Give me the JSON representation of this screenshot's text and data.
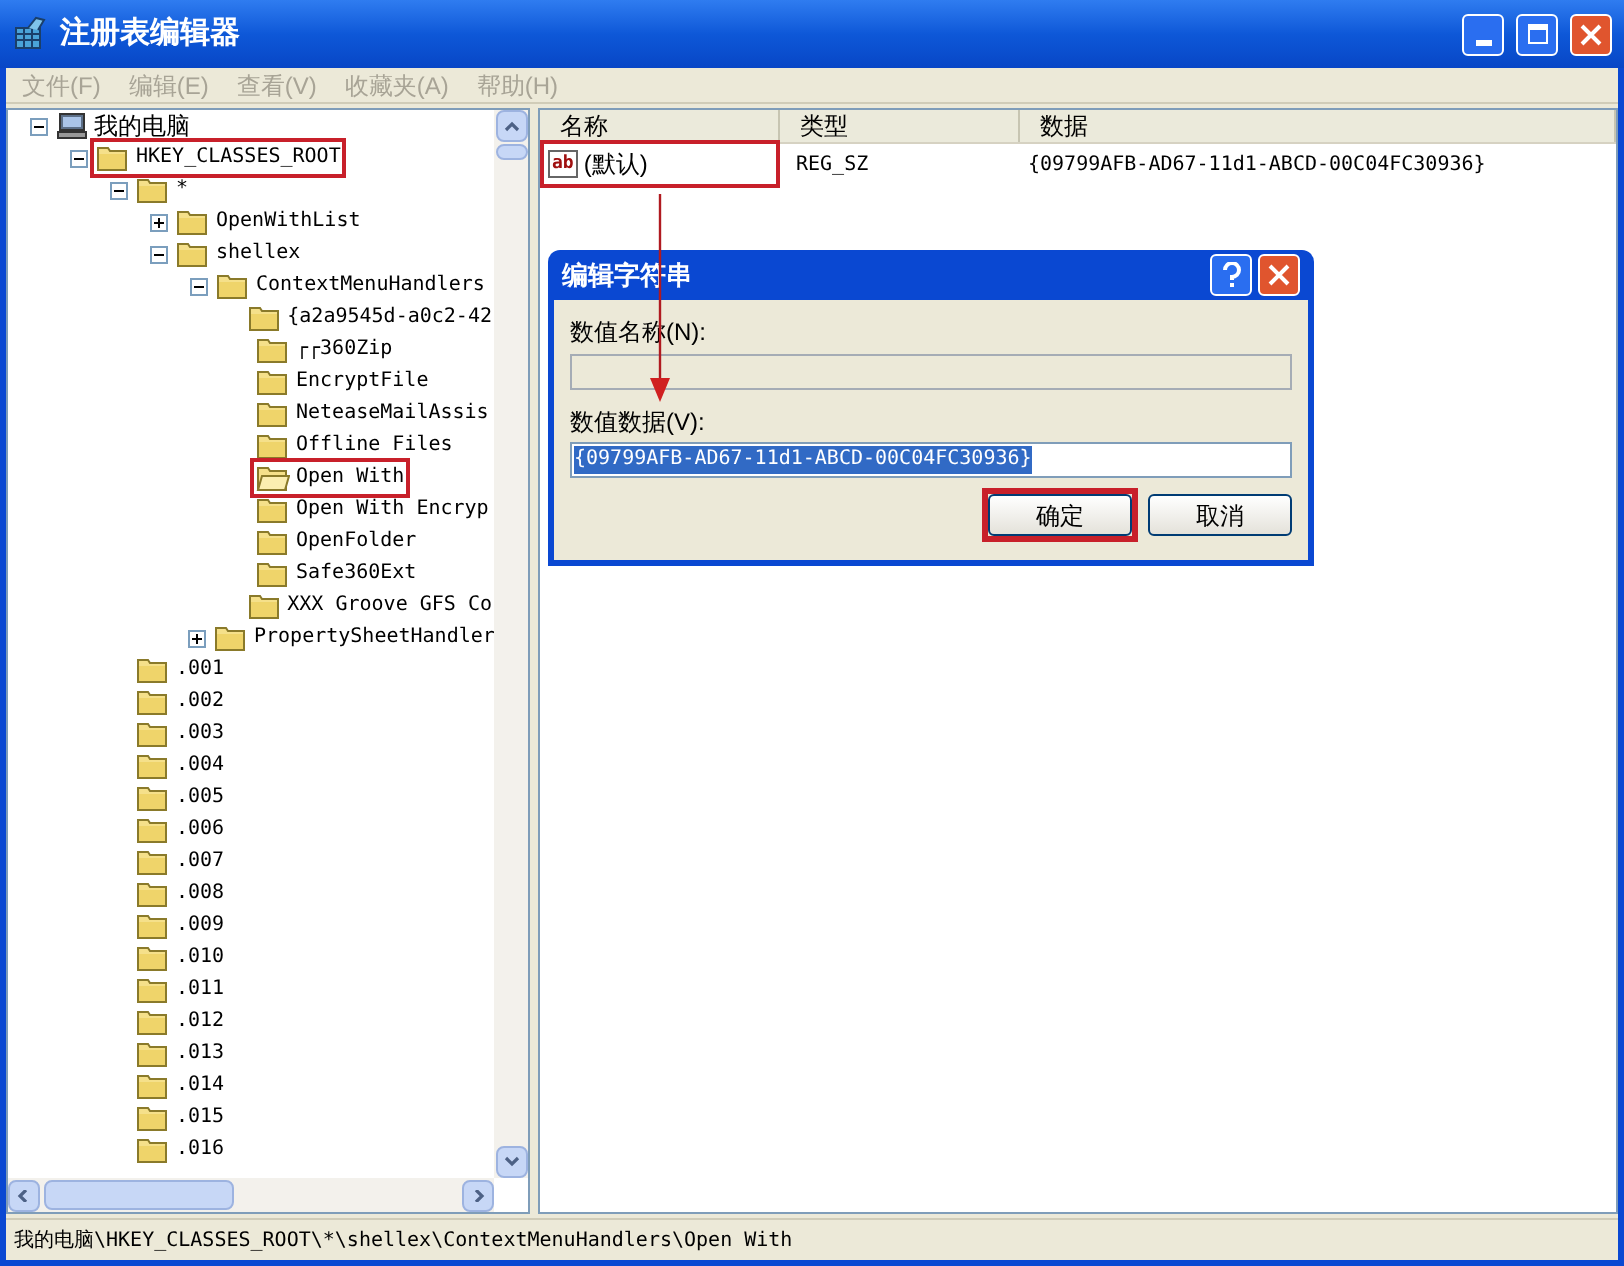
{
  "window": {
    "title": "注册表编辑器"
  },
  "menu": [
    {
      "label": "文件(F)"
    },
    {
      "label": "编辑(E)"
    },
    {
      "label": "查看(V)"
    },
    {
      "label": "收藏夹(A)"
    },
    {
      "label": "帮助(H)"
    }
  ],
  "tree": {
    "root": {
      "label": "我的电脑",
      "expanded": true,
      "highlighted": false,
      "children": [
        {
          "label": "HKEY_CLASSES_ROOT",
          "expanded": true,
          "selected": false,
          "highlighted": true,
          "children": [
            {
              "label": "*",
              "expanded": true,
              "selected": false,
              "highlighted": false,
              "children": [
                {
                  "label": "OpenWithList",
                  "expanded": false,
                  "selected": false,
                  "highlighted": false
                },
                {
                  "label": "shellex",
                  "expanded": true,
                  "selected": false,
                  "highlighted": false,
                  "children": [
                    {
                      "label": "ContextMenuHandlers",
                      "expanded": true,
                      "selected": false,
                      "highlighted": false,
                      "children": [
                        {
                          "label": "{a2a9545d-a0c2-42",
                          "selected": false,
                          "highlighted": false
                        },
                        {
                          "label": "┌┌360Zip",
                          "selected": false,
                          "highlighted": false
                        },
                        {
                          "label": "EncryptFile",
                          "selected": false,
                          "highlighted": false
                        },
                        {
                          "label": "NeteaseMailAssis",
                          "selected": false,
                          "highlighted": false
                        },
                        {
                          "label": "Offline Files",
                          "selected": false,
                          "highlighted": false
                        },
                        {
                          "label": "Open With",
                          "selected": true,
                          "highlighted": true
                        },
                        {
                          "label": "Open With Encryp",
                          "selected": false,
                          "highlighted": false
                        },
                        {
                          "label": "OpenFolder",
                          "selected": false,
                          "highlighted": false
                        },
                        {
                          "label": "Safe360Ext",
                          "selected": false,
                          "highlighted": false
                        },
                        {
                          "label": "XXX Groove GFS Co",
                          "selected": false,
                          "highlighted": false
                        }
                      ]
                    },
                    {
                      "label": "PropertySheetHandler",
                      "expanded": false,
                      "selected": false,
                      "highlighted": false
                    }
                  ]
                }
              ]
            },
            {
              "label": ".001",
              "selected": false,
              "highlighted": false
            },
            {
              "label": ".002",
              "selected": false,
              "highlighted": false
            },
            {
              "label": ".003",
              "selected": false,
              "highlighted": false
            },
            {
              "label": ".004",
              "selected": false,
              "highlighted": false
            },
            {
              "label": ".005",
              "selected": false,
              "highlighted": false
            },
            {
              "label": ".006",
              "selected": false,
              "highlighted": false
            },
            {
              "label": ".007",
              "selected": false,
              "highlighted": false
            },
            {
              "label": ".008",
              "selected": false,
              "highlighted": false
            },
            {
              "label": ".009",
              "selected": false,
              "highlighted": false
            },
            {
              "label": ".010",
              "selected": false,
              "highlighted": false
            },
            {
              "label": ".011",
              "selected": false,
              "highlighted": false
            },
            {
              "label": ".012",
              "selected": false,
              "highlighted": false
            },
            {
              "label": ".013",
              "selected": false,
              "highlighted": false
            },
            {
              "label": ".014",
              "selected": false,
              "highlighted": false
            },
            {
              "label": ".015",
              "selected": false,
              "highlighted": false
            },
            {
              "label": ".016",
              "selected": false,
              "highlighted": false
            }
          ]
        }
      ]
    }
  },
  "list": {
    "columns": [
      "名称",
      "类型",
      "数据"
    ],
    "rows": [
      {
        "icon_text": "ab",
        "name": "(默认)",
        "type": "REG_SZ",
        "data": "{09799AFB-AD67-11d1-ABCD-00C04FC30936}",
        "highlighted": true
      }
    ]
  },
  "dialog": {
    "title": "编辑字符串",
    "name_label": "数值名称(N):",
    "name_value_disabled": true,
    "data_label": "数值数据(V):",
    "data_value": "{09799AFB-AD67-11d1-ABCD-00C04FC30936}",
    "buttons": [
      {
        "label": "确定",
        "highlighted": true
      },
      {
        "label": "取消",
        "highlighted": false
      }
    ]
  },
  "status_bar": "我的电脑\\HKEY_CLASSES_ROOT\\*\\shellex\\ContextMenuHandlers\\Open With"
}
